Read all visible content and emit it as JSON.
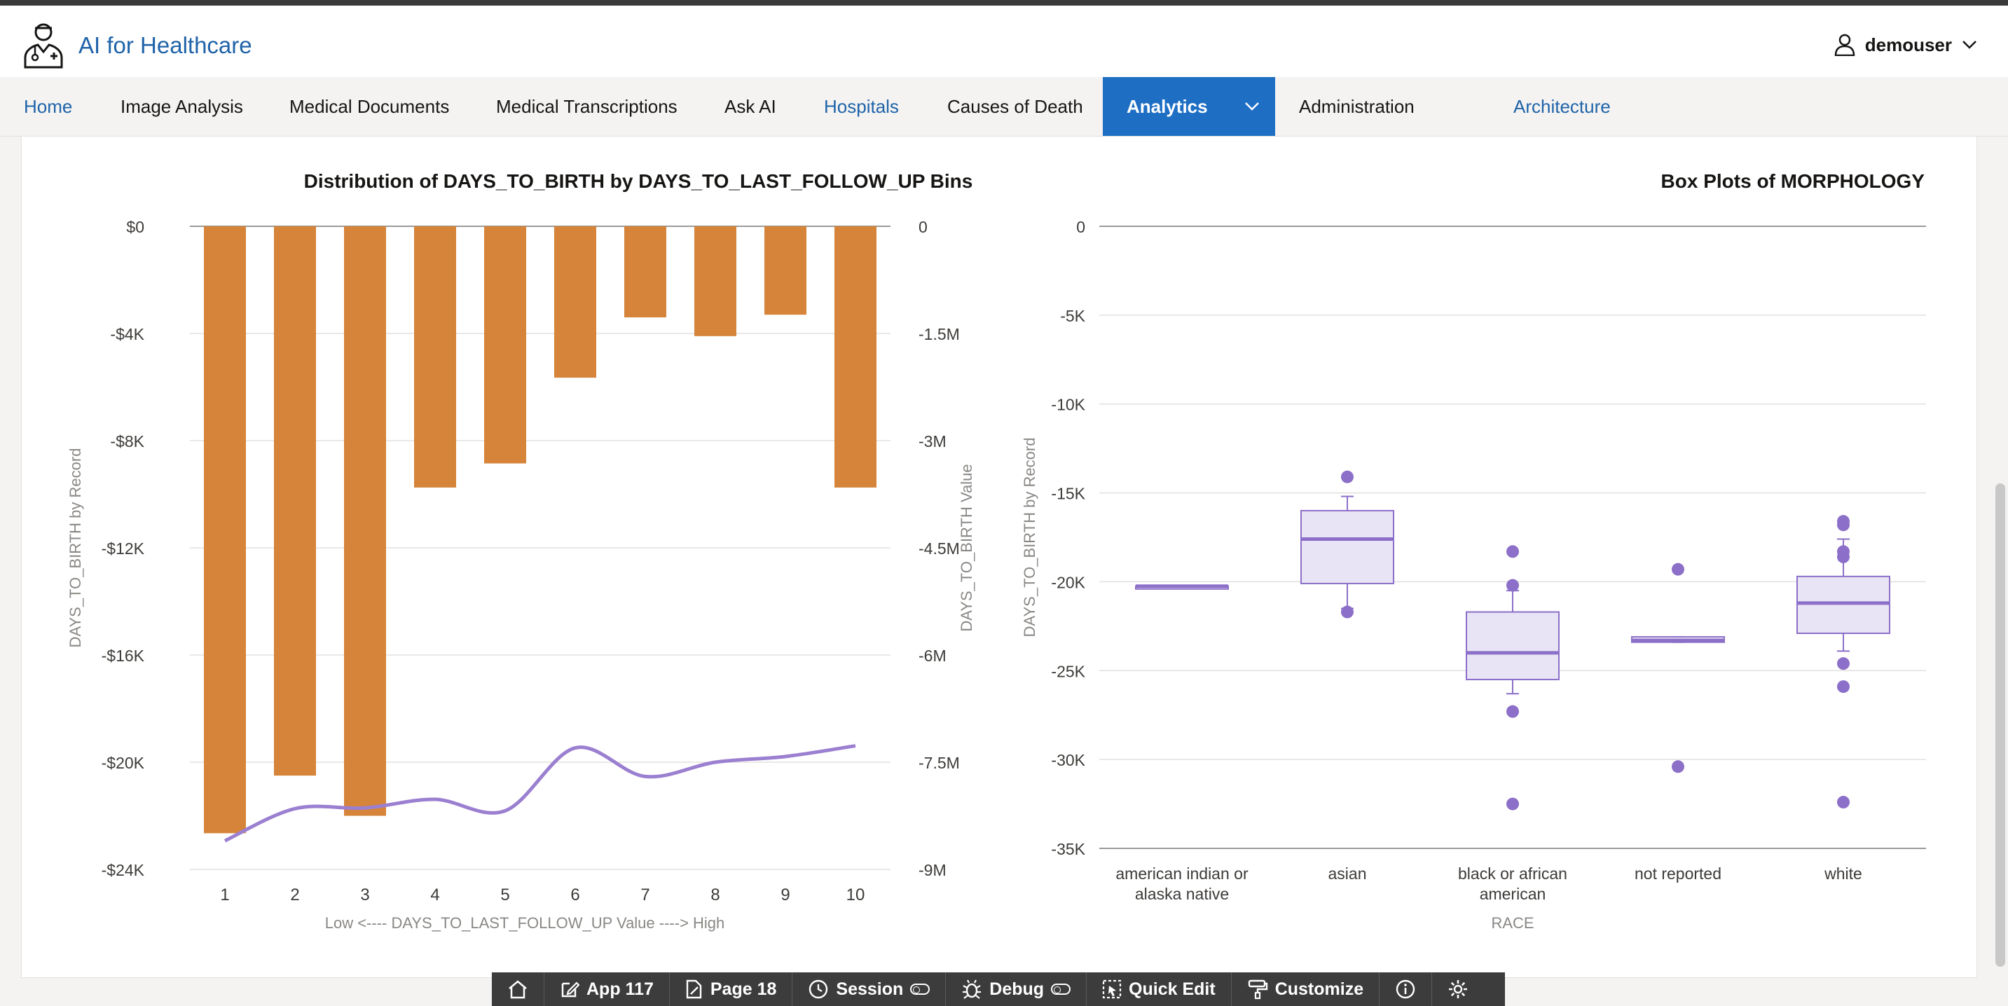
{
  "app": {
    "title": "AI for Healthcare"
  },
  "user": {
    "name": "demouser"
  },
  "nav": [
    {
      "label": "Home",
      "style": "blue"
    },
    {
      "label": "Image Analysis",
      "style": "normal"
    },
    {
      "label": "Medical Documents",
      "style": "normal"
    },
    {
      "label": "Medical Transcriptions",
      "style": "normal"
    },
    {
      "label": "Ask AI",
      "style": "normal"
    },
    {
      "label": "Hospitals",
      "style": "blue"
    },
    {
      "label": "Causes of Death",
      "style": "normal"
    },
    {
      "label": "Analytics",
      "style": "active"
    },
    {
      "label": "Administration",
      "style": "normal"
    },
    {
      "label": "Architecture",
      "style": "blue"
    }
  ],
  "devbar": {
    "app": "App 117",
    "page": "Page 18",
    "session": "Session",
    "debug": "Debug",
    "quick_edit": "Quick Edit",
    "customize": "Customize"
  },
  "colors": {
    "accent": "#1e6fc4",
    "bar": "#d5843a",
    "line": "#9b7fd0",
    "box_fill": "#e9e4f5",
    "box_stroke": "#8c6fc8"
  },
  "chart_data": [
    {
      "type": "bar",
      "title": "Distribution of DAYS_TO_BIRTH by DAYS_TO_LAST_FOLLOW_UP Bins",
      "xlabel": "Low <---- DAYS_TO_LAST_FOLLOW_UP Value ----> High",
      "ylabel": "DAYS_TO_BIRTH by Record",
      "y2label": "DAYS_TO_BIRTH Value",
      "categories": [
        "1",
        "2",
        "3",
        "4",
        "5",
        "6",
        "7",
        "8",
        "9",
        "10"
      ],
      "ylim": [
        -24000,
        0
      ],
      "yticks": [
        0,
        -4000,
        -8000,
        -12000,
        -16000,
        -20000,
        -24000
      ],
      "ytick_labels": [
        "$0",
        "-$4K",
        "-$8K",
        "-$12K",
        "-$16K",
        "-$20K",
        "-$24K"
      ],
      "y2lim": [
        -9000000,
        0
      ],
      "y2ticks": [
        0,
        -1500000,
        -3000000,
        -4500000,
        -6000000,
        -7500000,
        -9000000
      ],
      "y2tick_labels": [
        "0",
        "-1.5M",
        "-3M",
        "-4.5M",
        "-6M",
        "-7.5M",
        "-9M"
      ],
      "series": [
        {
          "kind": "bar",
          "axis": "left",
          "values": [
            -22650,
            -20500,
            -22000,
            -9750,
            -8850,
            -5650,
            -3400,
            -4100,
            -3300,
            -9750
          ]
        },
        {
          "kind": "line",
          "axis": "right",
          "values": [
            -8600000,
            -8150000,
            -8140000,
            -8020000,
            -8180000,
            -7300000,
            -7700000,
            -7500000,
            -7420000,
            -7270000
          ]
        }
      ],
      "grid": true
    },
    {
      "type": "box",
      "title": "Box Plots of MORPHOLOGY",
      "xlabel": "RACE",
      "ylabel": "DAYS_TO_BIRTH by Record",
      "categories": [
        "american indian or alaska native",
        "asian",
        "black or african american",
        "not reported",
        "white"
      ],
      "category_lines": [
        [
          "american indian or",
          "alaska native"
        ],
        [
          "asian"
        ],
        [
          "black or african",
          "american"
        ],
        [
          "not reported"
        ],
        [
          "white"
        ]
      ],
      "ylim": [
        -35000,
        0
      ],
      "yticks": [
        0,
        -5000,
        -10000,
        -15000,
        -20000,
        -25000,
        -30000,
        -35000
      ],
      "ytick_labels": [
        "0",
        "-5K",
        "-10K",
        "-15K",
        "-20K",
        "-25K",
        "-30K",
        "-35K"
      ],
      "boxes": [
        {
          "whisker_low": -20250,
          "q1": -20250,
          "median": -20250,
          "q3": -20250,
          "whisker_high": -20250,
          "outliers": []
        },
        {
          "whisker_low": -21500,
          "q1": -20100,
          "median": -17600,
          "q3": -16000,
          "whisker_high": -15200,
          "outliers": [
            -14100,
            -21700
          ]
        },
        {
          "whisker_low": -26300,
          "q1": -25500,
          "median": -24000,
          "q3": -21700,
          "whisker_high": -20500,
          "outliers": [
            -18300,
            -20200,
            -27300,
            -32500
          ]
        },
        {
          "whisker_low": -23400,
          "q1": -23400,
          "median": -23300,
          "q3": -23100,
          "whisker_high": -23100,
          "outliers": [
            -19300,
            -30400
          ]
        },
        {
          "whisker_low": -23900,
          "q1": -22900,
          "median": -21200,
          "q3": -19700,
          "whisker_high": -17600,
          "outliers": [
            -16600,
            -16800,
            -18300,
            -18600,
            -24600,
            -25900,
            -32400
          ]
        }
      ],
      "grid": true
    }
  ]
}
